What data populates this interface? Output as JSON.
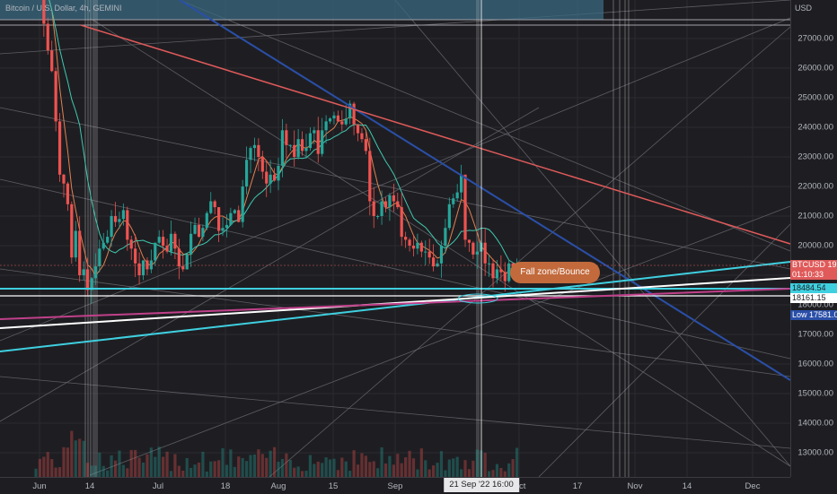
{
  "header": {
    "title": "Bitcoin / U.S. Dollar, 4h, GEMINI"
  },
  "colors": {
    "background": "#1e1e22",
    "up_candle": "#26a69a",
    "down_candle": "#ef5350",
    "cyan_line": "#3fd0e0",
    "red_line": "#e05a5a",
    "blue_line": "#2a4fa8",
    "magenta_line": "#c0408a",
    "white_line": "#ffffff",
    "callout": "#c26a3c"
  },
  "chart_data": {
    "type": "candlestick",
    "currency_label": "USD",
    "y_ticks": [
      {
        "value": 13000,
        "label": "13000.00"
      },
      {
        "value": 14000,
        "label": "14000.00"
      },
      {
        "value": 15000,
        "label": "15000.00"
      },
      {
        "value": 16000,
        "label": "16000.00"
      },
      {
        "value": 17000,
        "label": "17000.00"
      },
      {
        "value": 18000,
        "label": "18000.00"
      },
      {
        "value": 19000,
        "label": "19000.00"
      },
      {
        "value": 20000,
        "label": "20000.00"
      },
      {
        "value": 21000,
        "label": "21000.00"
      },
      {
        "value": 22000,
        "label": "22000.00"
      },
      {
        "value": 23000,
        "label": "23000.00"
      },
      {
        "value": 24000,
        "label": "24000.00"
      },
      {
        "value": 25000,
        "label": "25000.00"
      },
      {
        "value": 26000,
        "label": "26000.00"
      },
      {
        "value": 27000,
        "label": "27000.00"
      }
    ],
    "x_ticks": [
      "Jun",
      "14",
      "Jul",
      "18",
      "Aug",
      "15",
      "Sep",
      "Oct",
      "17",
      "Nov",
      "14",
      "Dec"
    ],
    "crosshair_time": "21 Sep '22   16:00",
    "price_tags": [
      {
        "label": "BTCUSD",
        "value": "19290.98",
        "sub": "01:10:33"
      },
      {
        "label": "",
        "value": "18484.54",
        "sub": ""
      },
      {
        "label": "",
        "value": "18161.15",
        "sub": ""
      },
      {
        "label": "Low",
        "value": "17581.01",
        "sub": ""
      }
    ],
    "annotation": "Fall zone/Bounce",
    "daily_closes": [
      30000,
      29800,
      27500,
      26600,
      25900,
      24200,
      22400,
      22100,
      21400,
      19600,
      20500,
      19000,
      19200,
      18500,
      18900,
      19300,
      19900,
      20100,
      20300,
      21000,
      20800,
      20900,
      21200,
      20200,
      19900,
      19400,
      19000,
      19500,
      19200,
      19500,
      20100,
      20300,
      20000,
      19800,
      20400,
      19900,
      19300,
      19200,
      19700,
      20400,
      20700,
      20300,
      20600,
      21100,
      21500,
      21300,
      20500,
      20600,
      20700,
      21100,
      21200,
      20800,
      22000,
      22900,
      23300,
      23400,
      23000,
      22500,
      22100,
      22400,
      22200,
      22700,
      23900,
      23400,
      23400,
      23000,
      23600,
      23200,
      23300,
      23800,
      23900,
      23100,
      23900,
      24200,
      24300,
      24400,
      24200,
      24100,
      24300,
      24800,
      24100,
      23800,
      23600,
      23200,
      21500,
      21000,
      21000,
      21500,
      21300,
      21700,
      21500,
      21300,
      20300,
      20200,
      20000,
      19900,
      20100,
      19800,
      19800,
      19600,
      19300,
      19400,
      20000,
      20600,
      21400,
      21600,
      21800,
      22400,
      20200,
      20100,
      19700,
      19800,
      20100,
      19400,
      19400,
      18900,
      19200,
      19100,
      18800,
      19400,
      19200,
      19300
    ]
  }
}
